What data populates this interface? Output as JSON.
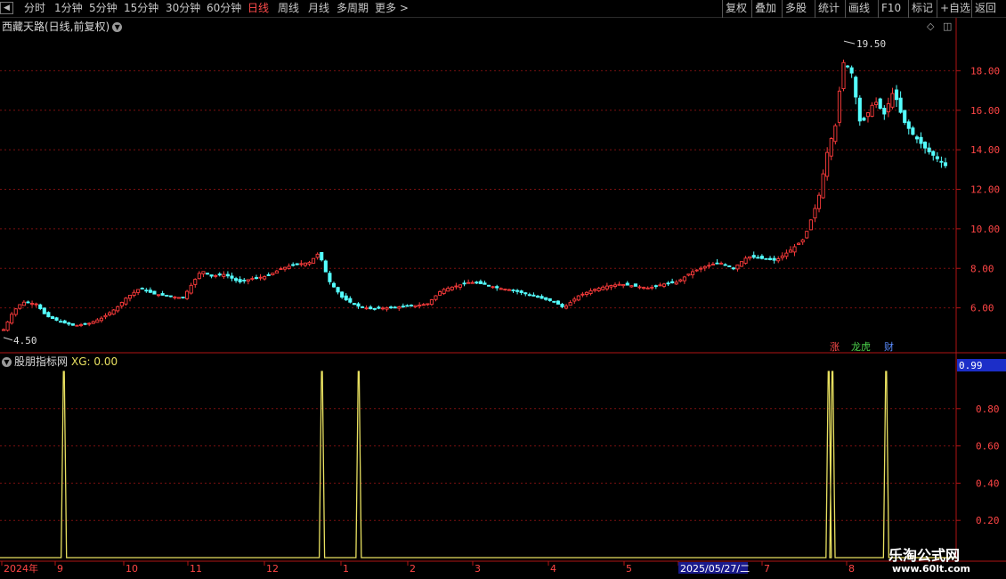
{
  "toolbar": {
    "back_icon": "back-arrow-icon",
    "periods": [
      "分时",
      "1分钟",
      "5分钟",
      "15分钟",
      "30分钟",
      "60分钟",
      "日线",
      "周线",
      "月线",
      "多周期",
      "更多 >"
    ],
    "active_period": "日线",
    "actions": [
      "复权",
      "叠加",
      "多股",
      "统计",
      "画线",
      "F10",
      "标记",
      "+自选",
      "返回"
    ]
  },
  "main_title": "西藏天路(日线,前复权)",
  "indicator_title": "股朋指标网",
  "indicator_value": "XG: 0.00",
  "badges": {
    "up": "涨",
    "dragon": "龙虎",
    "fin": "财"
  },
  "colors": {
    "up": "#ff3c3c",
    "down": "#54ffff",
    "signal": "#e8e060",
    "grid": "#7a1010",
    "axis": "#b01515",
    "date_highlight": "#1a1a8c"
  },
  "watermark": {
    "line1": "乐淘公式网",
    "line2": "www.60lt.com"
  },
  "chart_data": [
    {
      "type": "candlestick",
      "title": "西藏天路(日线,前复权)",
      "ylim": [
        4.0,
        20.0
      ],
      "y_ticks": [
        6.0,
        8.0,
        10.0,
        12.0,
        14.0,
        16.0,
        18.0
      ],
      "y_tick_labels": [
        "6.00",
        "8.00",
        "10.00",
        "12.00",
        "14.00",
        "16.00",
        "18.00"
      ],
      "annotations": [
        {
          "label": "19.50",
          "value": 19.5,
          "type": "max"
        },
        {
          "label": "4.50",
          "value": 4.5,
          "type": "min"
        }
      ],
      "x_labels": [
        "2024年",
        "9",
        "10",
        "11",
        "12",
        "1",
        "2",
        "3",
        "4",
        "5",
        "2025/05/27/二",
        "7",
        "8"
      ],
      "close_path": [
        {
          "t": 0.0,
          "c": 4.9
        },
        {
          "t": 0.01,
          "c": 5.8
        },
        {
          "t": 0.02,
          "c": 6.3
        },
        {
          "t": 0.035,
          "c": 6.2
        },
        {
          "t": 0.045,
          "c": 5.6
        },
        {
          "t": 0.06,
          "c": 5.3
        },
        {
          "t": 0.075,
          "c": 5.1
        },
        {
          "t": 0.09,
          "c": 5.2
        },
        {
          "t": 0.105,
          "c": 5.5
        },
        {
          "t": 0.12,
          "c": 6.0
        },
        {
          "t": 0.13,
          "c": 6.5
        },
        {
          "t": 0.145,
          "c": 7.0
        },
        {
          "t": 0.16,
          "c": 6.7
        },
        {
          "t": 0.175,
          "c": 6.6
        },
        {
          "t": 0.19,
          "c": 6.5
        },
        {
          "t": 0.2,
          "c": 7.2
        },
        {
          "t": 0.21,
          "c": 7.9
        },
        {
          "t": 0.22,
          "c": 7.6
        },
        {
          "t": 0.235,
          "c": 7.7
        },
        {
          "t": 0.25,
          "c": 7.3
        },
        {
          "t": 0.265,
          "c": 7.5
        },
        {
          "t": 0.28,
          "c": 7.6
        },
        {
          "t": 0.295,
          "c": 8.0
        },
        {
          "t": 0.31,
          "c": 8.2
        },
        {
          "t": 0.325,
          "c": 8.3
        },
        {
          "t": 0.335,
          "c": 8.8
        },
        {
          "t": 0.345,
          "c": 7.4
        },
        {
          "t": 0.36,
          "c": 6.5
        },
        {
          "t": 0.375,
          "c": 6.1
        },
        {
          "t": 0.39,
          "c": 5.95
        },
        {
          "t": 0.405,
          "c": 6.0
        },
        {
          "t": 0.42,
          "c": 6.05
        },
        {
          "t": 0.435,
          "c": 6.1
        },
        {
          "t": 0.45,
          "c": 6.2
        },
        {
          "t": 0.465,
          "c": 6.9
        },
        {
          "t": 0.48,
          "c": 7.1
        },
        {
          "t": 0.495,
          "c": 7.3
        },
        {
          "t": 0.51,
          "c": 7.2
        },
        {
          "t": 0.525,
          "c": 7.0
        },
        {
          "t": 0.54,
          "c": 6.9
        },
        {
          "t": 0.555,
          "c": 6.7
        },
        {
          "t": 0.57,
          "c": 6.5
        },
        {
          "t": 0.585,
          "c": 6.3
        },
        {
          "t": 0.595,
          "c": 6.0
        },
        {
          "t": 0.61,
          "c": 6.6
        },
        {
          "t": 0.625,
          "c": 6.9
        },
        {
          "t": 0.64,
          "c": 7.1
        },
        {
          "t": 0.655,
          "c": 7.2
        },
        {
          "t": 0.67,
          "c": 7.1
        },
        {
          "t": 0.685,
          "c": 7.0
        },
        {
          "t": 0.7,
          "c": 7.2
        },
        {
          "t": 0.715,
          "c": 7.3
        },
        {
          "t": 0.73,
          "c": 7.8
        },
        {
          "t": 0.745,
          "c": 8.1
        },
        {
          "t": 0.76,
          "c": 8.3
        },
        {
          "t": 0.775,
          "c": 8.0
        },
        {
          "t": 0.79,
          "c": 8.6
        },
        {
          "t": 0.805,
          "c": 8.5
        },
        {
          "t": 0.82,
          "c": 8.4
        },
        {
          "t": 0.835,
          "c": 8.9
        },
        {
          "t": 0.85,
          "c": 9.5
        },
        {
          "t": 0.865,
          "c": 11.5
        },
        {
          "t": 0.875,
          "c": 14.0
        },
        {
          "t": 0.885,
          "c": 15.5
        },
        {
          "t": 0.89,
          "c": 18.5
        },
        {
          "t": 0.9,
          "c": 18.0
        },
        {
          "t": 0.91,
          "c": 15.2
        },
        {
          "t": 0.925,
          "c": 16.5
        },
        {
          "t": 0.935,
          "c": 15.8
        },
        {
          "t": 0.945,
          "c": 17.0
        },
        {
          "t": 0.955,
          "c": 15.5
        },
        {
          "t": 0.965,
          "c": 14.8
        },
        {
          "t": 0.98,
          "c": 14.0
        },
        {
          "t": 1.0,
          "c": 13.2
        }
      ]
    },
    {
      "type": "line",
      "title": "股朋指标网",
      "ylim": [
        0,
        1
      ],
      "y_ticks": [
        0.2,
        0.4,
        0.6,
        0.8
      ],
      "y_tick_labels": [
        "0.20",
        "0.40",
        "0.60",
        "0.80"
      ],
      "current_value": "0.99",
      "series": [
        {
          "name": "XG",
          "signal_positions": [
            0.064,
            0.338,
            0.377,
            0.876,
            0.88,
            0.937
          ]
        }
      ]
    }
  ]
}
